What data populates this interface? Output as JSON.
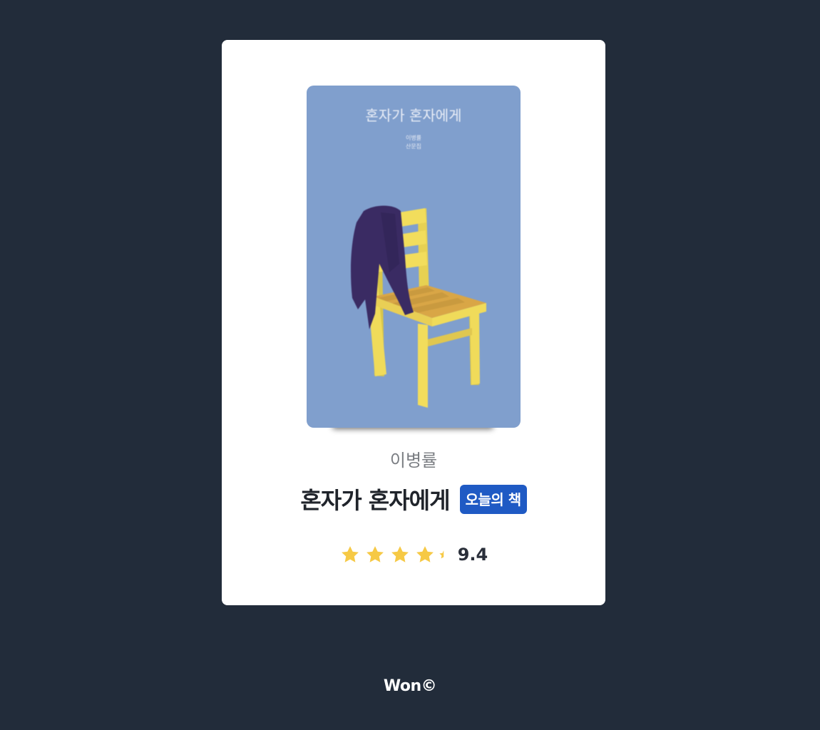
{
  "book": {
    "cover": {
      "title": "혼자가 혼자에게",
      "author_line1": "이병률",
      "author_line2": "산문집",
      "background_color": "#809fcd"
    },
    "author": "이병률",
    "title": "혼자가 혼자에게",
    "badge": "오늘의 책",
    "rating": {
      "value": "9.4",
      "stars": 4.5,
      "max_stars": 5,
      "star_color": "#f6c945"
    }
  },
  "footer": {
    "text": "Won©"
  }
}
